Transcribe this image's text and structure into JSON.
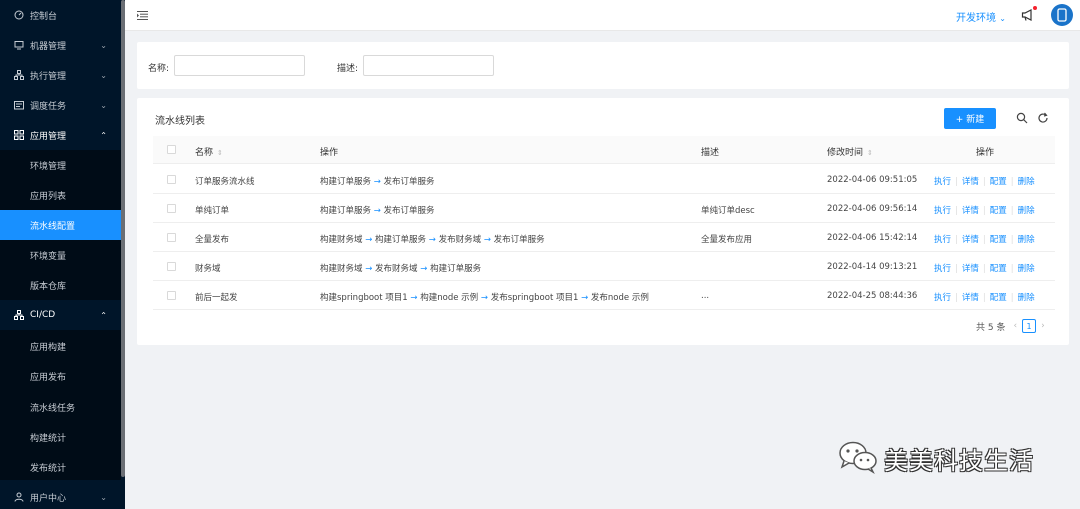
{
  "sidebar": {
    "items": [
      {
        "label": "控制台",
        "icon": "dashboard-icon"
      },
      {
        "label": "机器管理",
        "icon": "monitor-icon"
      },
      {
        "label": "执行管理",
        "icon": "cluster-icon"
      },
      {
        "label": "调度任务",
        "icon": "schedule-icon"
      },
      {
        "label": "应用管理",
        "icon": "apps-icon"
      },
      {
        "label": "CI/CD",
        "icon": "cluster-icon"
      },
      {
        "label": "用户中心",
        "icon": "user-icon"
      }
    ],
    "app_sub": [
      "环境管理",
      "应用列表",
      "流水线配置",
      "环境变量",
      "版本仓库"
    ],
    "cicd_sub": [
      "应用构建",
      "应用发布",
      "流水线任务",
      "构建统计",
      "发布统计"
    ]
  },
  "header": {
    "env_label": "开发环境",
    "env_chevron": "⌄"
  },
  "search": {
    "name_label": "名称:",
    "name_value": "",
    "desc_label": "描述:",
    "desc_value": ""
  },
  "list": {
    "title": "流水线列表",
    "new_button": "+ 新建",
    "columns": {
      "name": "名称",
      "ops_chain": "操作",
      "desc": "描述",
      "modified": "修改时间",
      "actions": "操作"
    },
    "rows": [
      {
        "name": "订单服务流水线",
        "chain": [
          "构建订单服务",
          "发布订单服务"
        ],
        "desc": "",
        "time": "2022-04-06 09:51:05"
      },
      {
        "name": "单纯订单",
        "chain": [
          "构建订单服务",
          "发布订单服务"
        ],
        "desc": "单纯订单desc",
        "time": "2022-04-06 09:56:14"
      },
      {
        "name": "全量发布",
        "chain": [
          "构建财务域",
          "构建订单服务",
          "发布财务域",
          "发布订单服务"
        ],
        "desc": "全量发布应用",
        "time": "2022-04-06 15:42:14"
      },
      {
        "name": "财务域",
        "chain": [
          "构建财务域",
          "发布财务域",
          "构建订单服务"
        ],
        "desc": "",
        "time": "2022-04-14 09:13:21"
      },
      {
        "name": "前后一起发",
        "chain": [
          "构建springboot 项目1",
          "构建node 示例",
          "发布springboot 项目1",
          "发布node 示例"
        ],
        "desc": "...",
        "time": "2022-04-25 08:44:36"
      }
    ],
    "row_actions": [
      "执行",
      "详情",
      "配置",
      "删除"
    ],
    "arrow_glyph": "→",
    "sort_glyph": "⇕",
    "pager": {
      "total": "共 5 条",
      "current": "1",
      "prev": "‹",
      "next": "›"
    }
  },
  "watermark": {
    "text": "美美科技生活"
  },
  "colors": {
    "sidebar_bg": "#001529",
    "accent": "#1890ff",
    "page_bg": "#f0f2f5"
  }
}
